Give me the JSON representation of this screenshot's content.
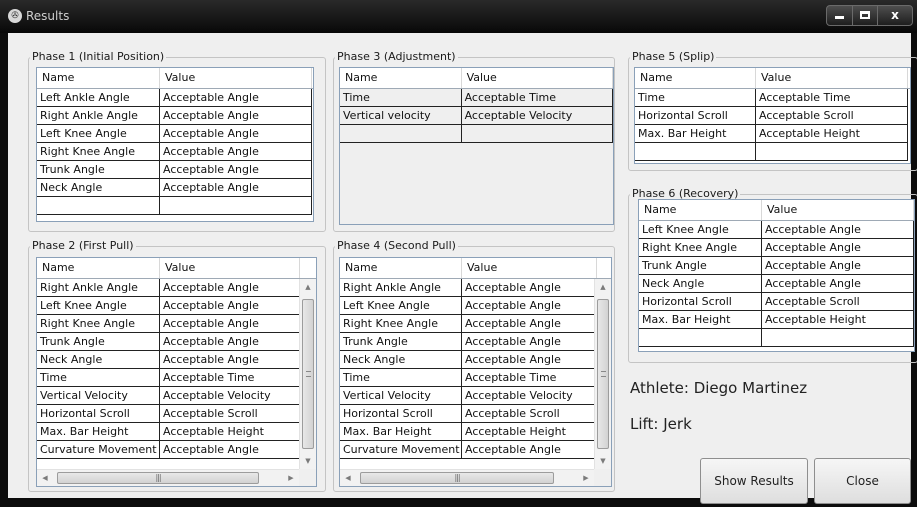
{
  "window": {
    "title": "Results",
    "icon": "app-icon"
  },
  "columns": {
    "name": "Name",
    "value": "Value"
  },
  "phase1": {
    "title": "Phase 1 (Initial Position)",
    "rows": [
      [
        "Left Ankle Angle",
        "Acceptable Angle"
      ],
      [
        "Right Ankle Angle",
        "Acceptable Angle"
      ],
      [
        "Left Knee Angle",
        "Acceptable Angle"
      ],
      [
        "Right Knee Angle",
        "Acceptable Angle"
      ],
      [
        "Trunk Angle",
        "Acceptable Angle"
      ],
      [
        "Neck Angle",
        "Acceptable Angle"
      ],
      [
        "",
        ""
      ]
    ]
  },
  "phase2": {
    "title": "Phase 2 (First Pull)",
    "rows": [
      [
        "Right Ankle Angle",
        "Acceptable Angle"
      ],
      [
        "Left Knee Angle",
        "Acceptable Angle"
      ],
      [
        "Right Knee Angle",
        "Acceptable Angle"
      ],
      [
        "Trunk Angle",
        "Acceptable Angle"
      ],
      [
        "Neck Angle",
        "Acceptable Angle"
      ],
      [
        "Time",
        "Acceptable Time"
      ],
      [
        "Vertical Velocity",
        "Acceptable Velocity"
      ],
      [
        "Horizontal Scroll",
        "Acceptable Scroll"
      ],
      [
        "Max. Bar Height",
        "Acceptable Height"
      ],
      [
        "Curvature Movement",
        "Acceptable Angle"
      ]
    ]
  },
  "phase3": {
    "title": "Phase 3 (Adjustment)",
    "rows": [
      [
        "Time",
        "Acceptable Time"
      ],
      [
        "Vertical velocity",
        "Acceptable Velocity"
      ],
      [
        "",
        ""
      ]
    ]
  },
  "phase4": {
    "title": "Phase 4 (Second Pull)",
    "rows": [
      [
        "Right Ankle Angle",
        "Acceptable Angle"
      ],
      [
        "Left Knee Angle",
        "Acceptable Angle"
      ],
      [
        "Right Knee Angle",
        "Acceptable Angle"
      ],
      [
        "Trunk Angle",
        "Acceptable Angle"
      ],
      [
        "Neck Angle",
        "Acceptable Angle"
      ],
      [
        "Time",
        "Acceptable Time"
      ],
      [
        "Vertical Velocity",
        "Acceptable Velocity"
      ],
      [
        "Horizontal Scroll",
        "Acceptable Scroll"
      ],
      [
        "Max. Bar Height",
        "Acceptable Height"
      ],
      [
        "Curvature Movement",
        "Acceptable Angle"
      ]
    ]
  },
  "phase5": {
    "title": "Phase 5 (Splip)",
    "rows": [
      [
        "Time",
        "Acceptable Time"
      ],
      [
        "Horizontal Scroll",
        "Acceptable Scroll"
      ],
      [
        "Max. Bar Height",
        "Acceptable Height"
      ],
      [
        "",
        ""
      ]
    ]
  },
  "phase6": {
    "title": "Phase 6 (Recovery)",
    "rows": [
      [
        "Left Knee Angle",
        "Acceptable Angle"
      ],
      [
        "Right Knee Angle",
        "Acceptable Angle"
      ],
      [
        "Trunk Angle",
        "Acceptable Angle"
      ],
      [
        "Neck Angle",
        "Acceptable Angle"
      ],
      [
        "Horizontal Scroll",
        "Acceptable Scroll"
      ],
      [
        "Max. Bar Height",
        "Acceptable Height"
      ],
      [
        "",
        ""
      ]
    ]
  },
  "info": {
    "athlete": "Athlete: Diego Martinez",
    "lift": "Lift: Jerk"
  },
  "buttons": {
    "show_results": "Show Results",
    "close": "Close"
  }
}
